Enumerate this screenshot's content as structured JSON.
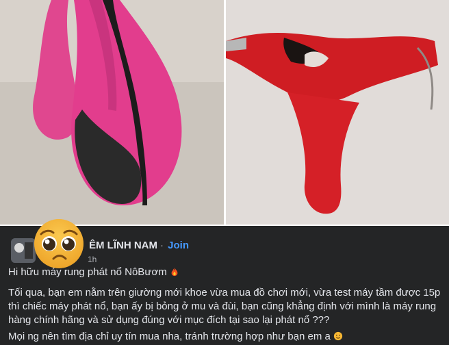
{
  "post": {
    "group_name_partial": "ÊM LĨNH NAM",
    "join_label": "Join",
    "dot": "·",
    "time": "1h",
    "title_line": "Hi hữu máy rung phát nổ NôBươm",
    "paragraph_1": "Tối qua, bạn em nằm trên giường mới khoe vừa mua đồ chơi mới, vừa test máy tầm được 15p thì chiếc máy phát nổ, bạn ấy bị bỏng ở mu và đùi, bạn cũng khẳng định với mình là máy rung hàng chính hãng và sử dụng đúng với mục đích tại sao lại phát nổ ???",
    "paragraph_2": "Mọi ng nên tìm địa chỉ uy tín mua nha, tránh trường hợp như bạn em a"
  },
  "icons": {
    "fire": "fire-icon",
    "pleading_face": "pleading-face-emoji",
    "small_emoji": "smile-emoji"
  },
  "colors": {
    "post_bg": "#242526",
    "text": "#e4e6eb",
    "muted": "#b0b3b8",
    "join": "#4599ff"
  }
}
